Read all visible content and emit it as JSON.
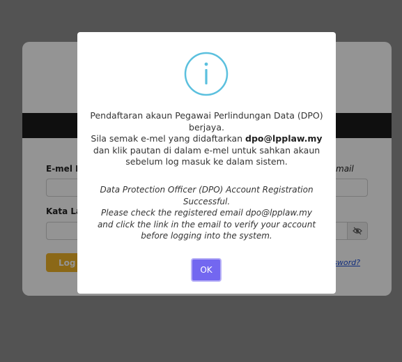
{
  "login_form": {
    "email_label": "E-mel Ra",
    "email_label_right": "mail",
    "password_label": "Kata La",
    "login_button": "Log",
    "forgot_link": "sword?"
  },
  "modal": {
    "icon": "info-icon",
    "message_ms_line1": "Pendaftaran akaun Pegawai Perlindungan Data (DPO) berjaya.",
    "message_ms_line2_prefix": "Sila semak e-mel yang didaftarkan ",
    "message_ms_email": "dpo@lpplaw.my",
    "message_ms_line3": "dan klik pautan di dalam e-mel untuk sahkan akaun sebelum log masuk ke dalam sistem.",
    "message_en_line1": "Data Protection Officer (DPO) Account Registration Successful.",
    "message_en_line2": "Please check the registered email dpo@lpplaw.my",
    "message_en_line3": "and click the link in the email to verify your account before logging into the system.",
    "ok_button": "OK"
  },
  "colors": {
    "ok_button": "#7367f0",
    "info_icon": "#5bc0de",
    "login_button": "#f0b429"
  }
}
